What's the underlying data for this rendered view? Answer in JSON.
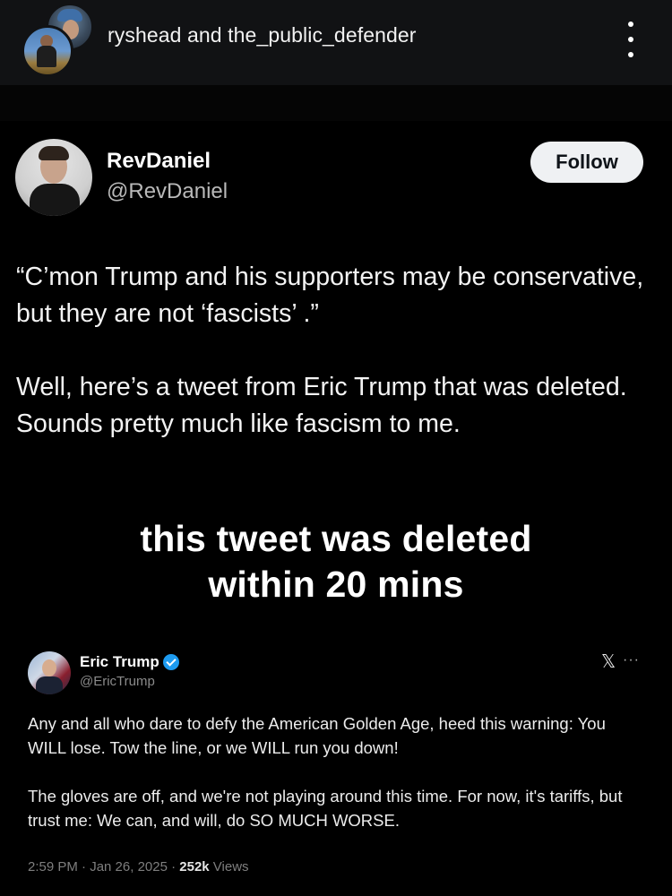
{
  "header": {
    "title": "ryshead and the_public_defender",
    "menu_icon": "more-vertical-icon"
  },
  "post": {
    "author_name": "RevDaniel",
    "author_handle": "@RevDaniel",
    "follow_label": "Follow",
    "paragraphs": [
      "“C’mon Trump and his supporters may be conservative, but they are not ‘fascists’ .”",
      "Well, here’s a tweet from Eric Trump that was deleted.  Sounds pretty much like fascism to me."
    ]
  },
  "video": {
    "caption_line1": "this tweet was deleted",
    "caption_line2": "within 20 mins"
  },
  "embedded_tweet": {
    "author_name": "Eric Trump",
    "author_handle": "@EricTrump",
    "verified_icon": "verified-badge-icon",
    "x_logo": "x-logo-icon",
    "paragraphs": [
      "Any and all who dare to defy the American Golden Age, heed this warning: You WILL lose. Tow the line, or we WILL run you down!",
      "The gloves are off, and we're not playing around this time. For now, it's tariffs, but trust me: We can, and will, do SO MUCH WORSE."
    ],
    "time_date": "2:59 PM · Jan 26, 2025 · ",
    "views_count": "252k",
    "views_label": " Views"
  },
  "colors": {
    "background": "#000000",
    "header_bg": "#111214",
    "verified": "#1d9bf0",
    "follow_bg": "#eff1f3"
  }
}
